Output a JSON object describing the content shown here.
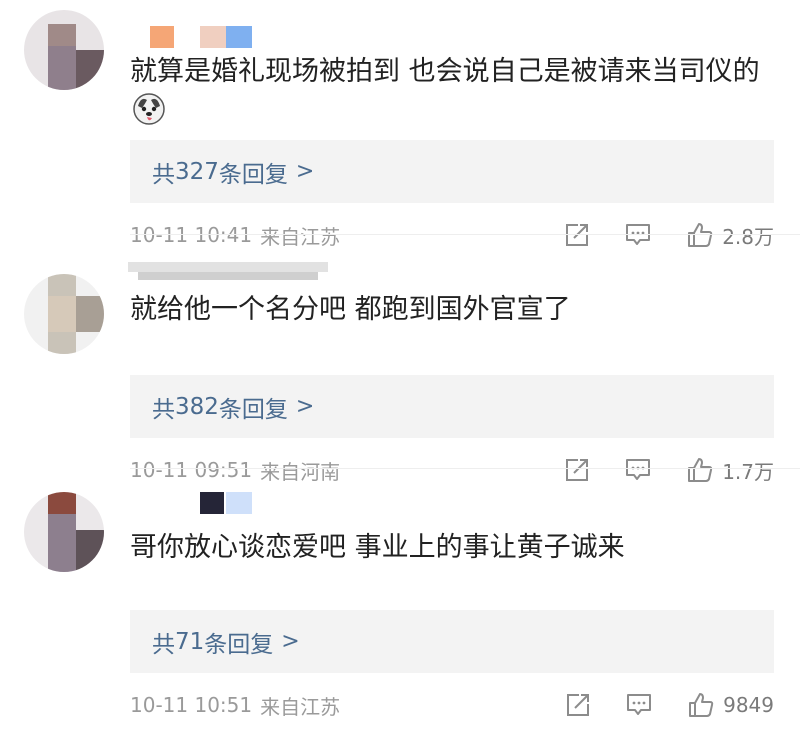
{
  "comments": [
    {
      "text": "就算是婚礼现场被拍到 也会说自己是被请来当司仪的",
      "emoji_name": "husky-dog-emoji-icon",
      "replies_prefix": "共",
      "replies_count": "327",
      "replies_suffix": "条回复",
      "replies_chevron": ">",
      "time": "10-11 10:41",
      "location": "来自江苏",
      "likes": "2.8万"
    },
    {
      "text": "就给他一个名分吧 都跑到国外官宣了",
      "replies_prefix": "共",
      "replies_count": "382",
      "replies_suffix": "条回复",
      "replies_chevron": ">",
      "time": "10-11 09:51",
      "location": "来自河南",
      "likes": "1.7万"
    },
    {
      "text": "哥你放心谈恋爱吧 事业上的事让黄子诚来",
      "replies_prefix": "共",
      "replies_count": "71",
      "replies_suffix": "条回复",
      "replies_chevron": ">",
      "time": "10-11 10:51",
      "location": "来自江苏",
      "likes": "9849"
    }
  ],
  "icons": {
    "share": "share-icon",
    "comment": "comment-icon",
    "like": "like-icon"
  },
  "colors": {
    "reply_link": "#4a6b8f",
    "meta": "#9a9a9a",
    "reply_bg": "#f3f3f3"
  }
}
